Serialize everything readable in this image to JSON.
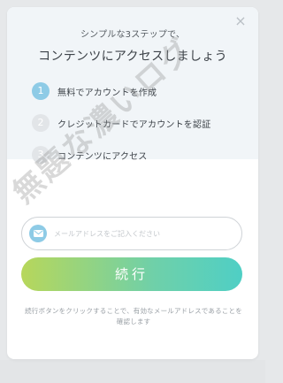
{
  "modal": {
    "subtitle": "シンプルな3ステップで、",
    "title": "コンテンツにアクセスしましょう",
    "close_icon": "×",
    "steps": [
      {
        "number": "1",
        "label": "無料でアカウントを作成",
        "active": true
      },
      {
        "number": "2",
        "label": "クレジットカードでアカウントを認証",
        "active": false
      },
      {
        "number": "3",
        "label": "コンテンツにアクセス",
        "active": false
      }
    ],
    "email": {
      "placeholder": "メールアドレスをご記入ください",
      "value": "",
      "icon": "mail-icon"
    },
    "submit_label": "続行",
    "note": "続行ボタンをクリックすることで、有効なメールアドレスであることを確認します"
  },
  "watermark": "無題な濃いログ",
  "colors": {
    "accent_blue": "#8ecbe6",
    "button_gradient_start": "#b7d75b",
    "button_gradient_end": "#4fcfc5",
    "panel_top_bg": "#f1f5f8"
  }
}
